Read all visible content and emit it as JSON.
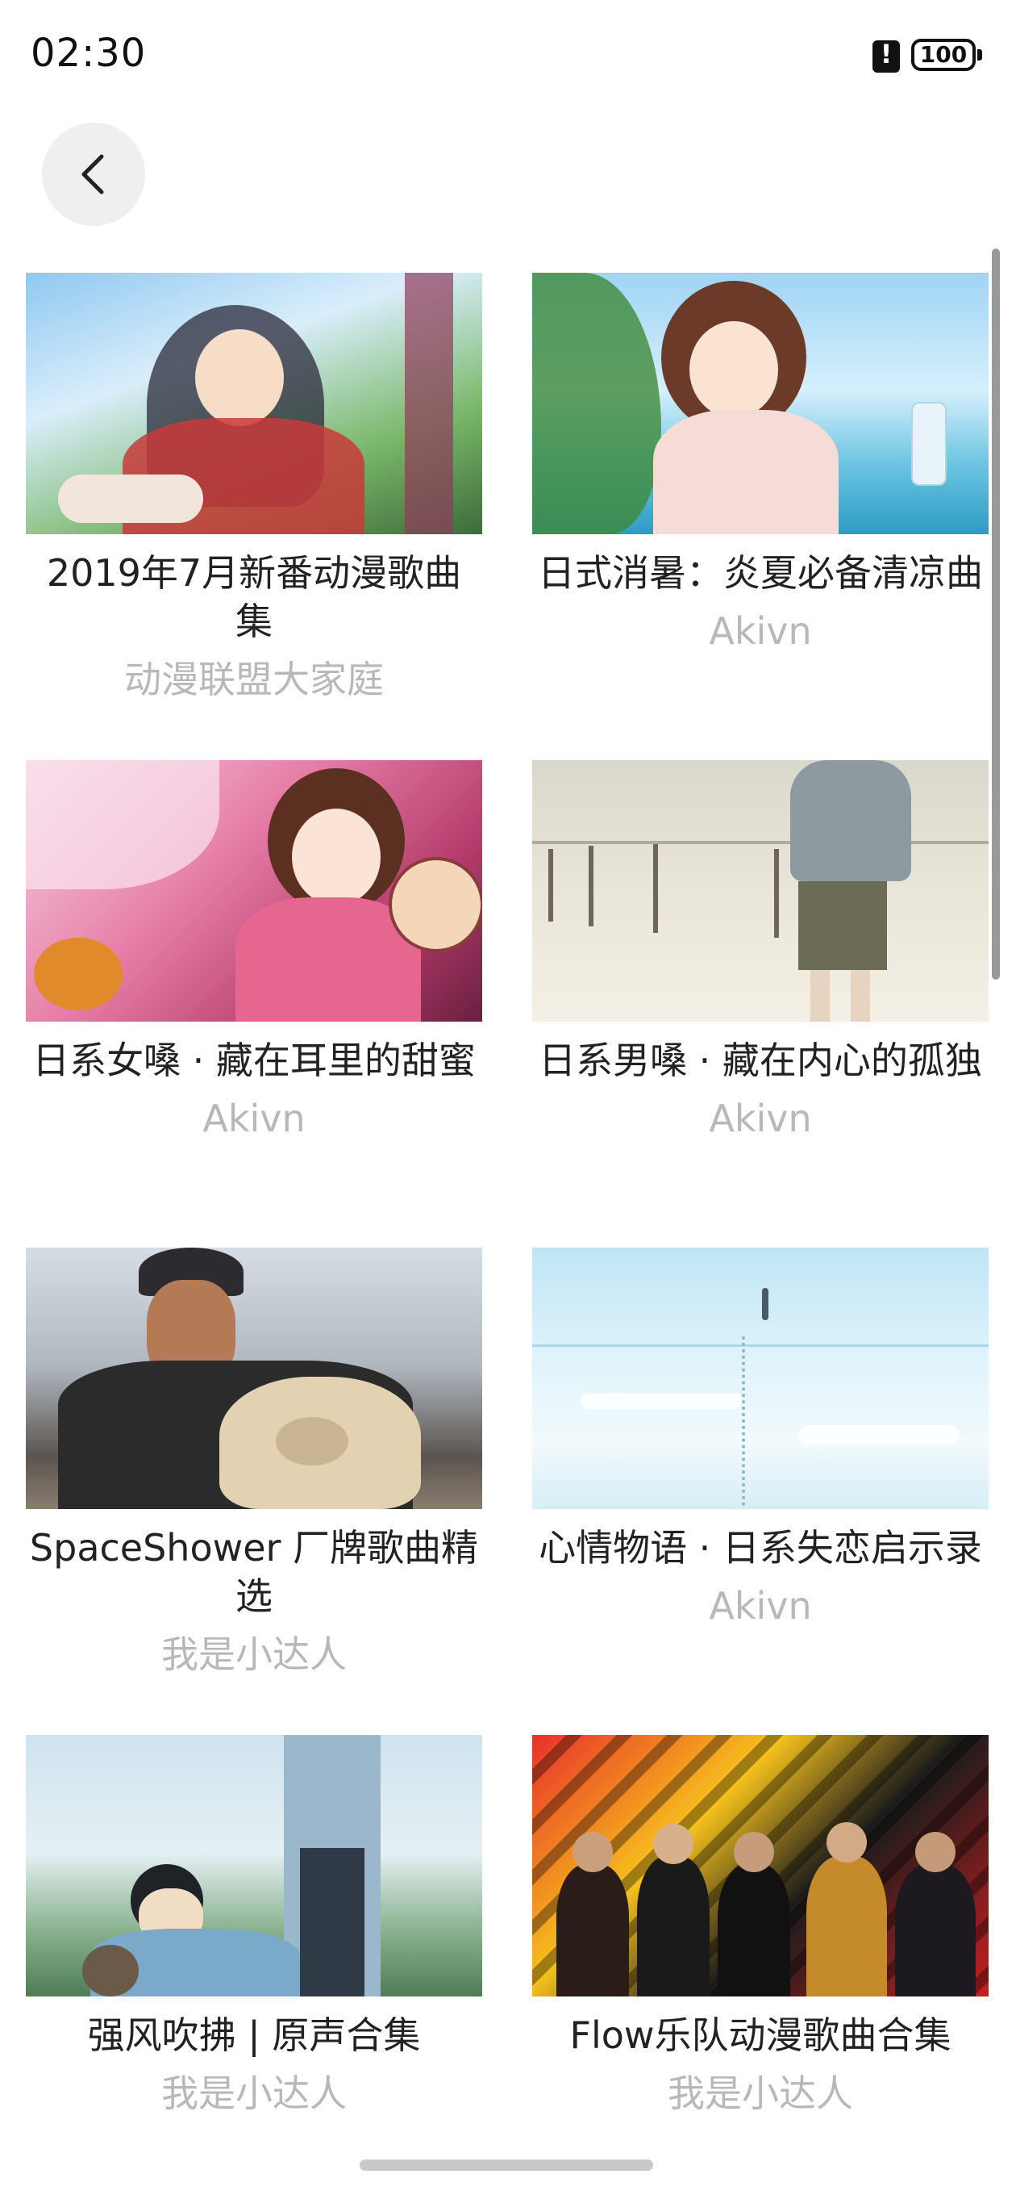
{
  "status_bar": {
    "time": "02:30",
    "battery": "100"
  },
  "header": {
    "back_icon": "chevron-left-icon"
  },
  "playlists": [
    {
      "title": "2019年7月新番动漫歌曲集",
      "author": "动漫联盟大家庭"
    },
    {
      "title": "日式消暑：炎夏必备清凉曲",
      "author": "Akivn"
    },
    {
      "title": "日系女嗓 · 藏在耳里的甜蜜",
      "author": "Akivn"
    },
    {
      "title": "日系男嗓 · 藏在内心的孤独",
      "author": "Akivn"
    },
    {
      "title": "SpaceShower 厂牌歌曲精选",
      "author": "我是小达人"
    },
    {
      "title": "心情物语 · 日系失恋启示录",
      "author": "Akivn"
    },
    {
      "title": "强风吹拂 | 原声合集",
      "author": "我是小达人"
    },
    {
      "title": "Flow乐队动漫歌曲合集",
      "author": "我是小达人"
    }
  ]
}
